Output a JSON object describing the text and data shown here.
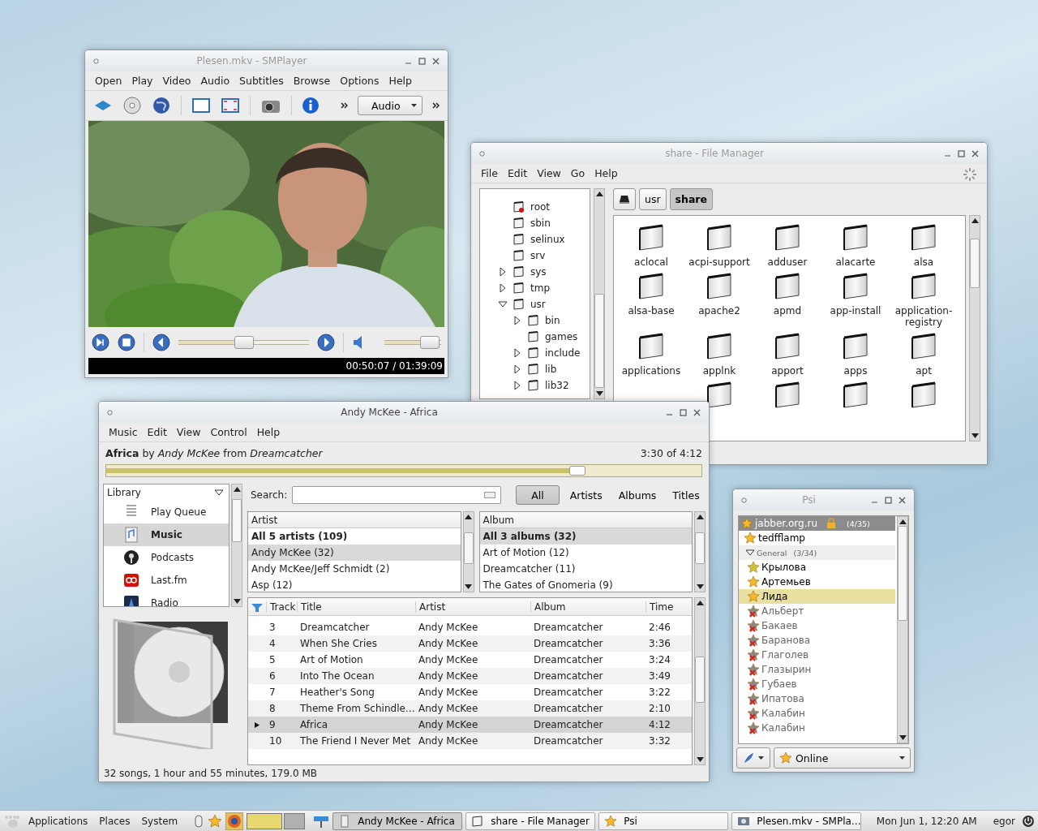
{
  "smplayer": {
    "title": "Plesen.mkv - SMPlayer",
    "active": false,
    "menu": [
      "Open",
      "Play",
      "Video",
      "Audio",
      "Subtitles",
      "Browse",
      "Options",
      "Help"
    ],
    "audio_combo": "Audio",
    "seek": {
      "level": 0.5
    },
    "volume": {
      "level": 0.95
    },
    "time": "00:50:07 / 01:39:09"
  },
  "file_manager": {
    "title": "share - File Manager",
    "active": false,
    "menu": [
      "File",
      "Edit",
      "View",
      "Go",
      "Help"
    ],
    "path": [
      {
        "label": "usr",
        "selected": false
      },
      {
        "label": "share",
        "selected": true
      }
    ],
    "tree": [
      {
        "name": "root",
        "kind": "restricted"
      },
      {
        "name": "sbin",
        "kind": "folder"
      },
      {
        "name": "selinux",
        "kind": "folder"
      },
      {
        "name": "srv",
        "kind": "folder"
      },
      {
        "name": "sys",
        "kind": "folder",
        "expanded": false
      },
      {
        "name": "tmp",
        "kind": "folder",
        "expanded": false
      },
      {
        "name": "usr",
        "kind": "folder",
        "expanded": true,
        "children": [
          {
            "name": "bin",
            "kind": "folder",
            "expanded": false
          },
          {
            "name": "games",
            "kind": "folder"
          },
          {
            "name": "include",
            "kind": "folder",
            "expanded": false
          },
          {
            "name": "lib",
            "kind": "folder",
            "expanded": false
          },
          {
            "name": "lib32",
            "kind": "folder",
            "expanded": false
          }
        ]
      }
    ],
    "folders": [
      "aclocal",
      "acpi-support",
      "adduser",
      "alacarte",
      "alsa",
      "alsa-base",
      "apache2",
      "apmd",
      "app-install",
      "application-registry",
      "applications",
      "applnk",
      "apport",
      "apps",
      "apt"
    ]
  },
  "music_player": {
    "title": "Andy McKee - Africa",
    "active": true,
    "menu": [
      "Music",
      "Edit",
      "View",
      "Control",
      "Help"
    ],
    "now_playing": "**Africa** by *Andy McKee* from *Dreamcatcher*",
    "position": "3:30 of 4:12",
    "progress": {
      "level": 0.8
    },
    "library_label": "Library",
    "sources": [
      {
        "label": "Play Queue",
        "kind": "queue",
        "selected": false
      },
      {
        "label": "Music",
        "kind": "music",
        "selected": true
      },
      {
        "label": "Podcasts",
        "kind": "podcast",
        "selected": false
      },
      {
        "label": "Last.fm",
        "kind": "lastfm",
        "selected": false
      },
      {
        "label": "Radio",
        "kind": "radio",
        "selected": false
      }
    ],
    "search_label": "Search:",
    "filters": [
      {
        "label": "All",
        "selected": true
      },
      {
        "label": "Artists",
        "selected": false
      },
      {
        "label": "Albums",
        "selected": false
      },
      {
        "label": "Titles",
        "selected": false
      }
    ],
    "artists": {
      "header": "Artist",
      "rows": [
        {
          "label": "All 5 artists (109)",
          "kind": "all",
          "selected": false
        },
        {
          "label": "Andy McKee (32)",
          "kind": "item",
          "selected": true
        },
        {
          "label": "Andy McKee/Jeff Schmidt (2)",
          "kind": "item",
          "selected": false
        },
        {
          "label": "Asp (12)",
          "kind": "item",
          "selected": false
        }
      ]
    },
    "albums": {
      "header": "Album",
      "rows": [
        {
          "label": "All 3 albums (32)",
          "kind": "all",
          "selected": true
        },
        {
          "label": "Art of Motion (12)",
          "kind": "item",
          "selected": false
        },
        {
          "label": "Dreamcatcher (11)",
          "kind": "item",
          "selected": false
        },
        {
          "label": "The Gates of Gnomeria (9)",
          "kind": "item",
          "selected": false
        }
      ]
    },
    "tracks": {
      "columns": [
        "Track",
        "Title",
        "Artist",
        "Album",
        "Time"
      ],
      "rows": [
        {
          "track": "3",
          "title": "Dreamcatcher",
          "artist": "Andy McKee",
          "album": "Dreamcatcher",
          "time": "2:46",
          "playing": false,
          "selected": false
        },
        {
          "track": "4",
          "title": "When She Cries",
          "artist": "Andy McKee",
          "album": "Dreamcatcher",
          "time": "3:36",
          "playing": false,
          "selected": false
        },
        {
          "track": "5",
          "title": "Art of Motion",
          "artist": "Andy McKee",
          "album": "Dreamcatcher",
          "time": "3:24",
          "playing": false,
          "selected": false
        },
        {
          "track": "6",
          "title": "Into The Ocean",
          "artist": "Andy McKee",
          "album": "Dreamcatcher",
          "time": "3:49",
          "playing": false,
          "selected": false
        },
        {
          "track": "7",
          "title": "Heather's Song",
          "artist": "Andy McKee",
          "album": "Dreamcatcher",
          "time": "3:22",
          "playing": false,
          "selected": false
        },
        {
          "track": "8",
          "title": "Theme From Schindle…",
          "artist": "Andy McKee",
          "album": "Dreamcatcher",
          "time": "2:10",
          "playing": false,
          "selected": false
        },
        {
          "track": "9",
          "title": "Africa",
          "artist": "Andy McKee",
          "album": "Dreamcatcher",
          "time": "4:12",
          "playing": true,
          "selected": true
        },
        {
          "track": "10",
          "title": "The Friend I Never Met",
          "artist": "Andy McKee",
          "album": "Dreamcatcher",
          "time": "3:32",
          "playing": false,
          "selected": false
        }
      ]
    },
    "status": "32 songs, 1 hour and 55 minutes, 179.0 MB"
  },
  "psi": {
    "title": "Psi",
    "active": false,
    "account": {
      "name": "jabber.org.ru",
      "count": "(4/35)",
      "contacts": [
        {
          "name": "tedfflamp",
          "kind": "online",
          "selected": false
        }
      ],
      "groups": [
        {
          "name": "General",
          "count": "(3/34)",
          "expanded": true,
          "contacts": [
            {
              "name": "Крылова",
              "kind": "chat",
              "selected": false
            },
            {
              "name": "Артемьев",
              "kind": "online",
              "selected": false
            },
            {
              "name": "Лида",
              "kind": "online",
              "selected": true
            },
            {
              "name": "Альберт",
              "kind": "offline",
              "selected": false
            },
            {
              "name": "Бакаев",
              "kind": "offline",
              "selected": false
            },
            {
              "name": "Баранова",
              "kind": "offline",
              "selected": false
            },
            {
              "name": "Глаголев",
              "kind": "offline",
              "selected": false
            },
            {
              "name": "Глазырин",
              "kind": "offline",
              "selected": false
            },
            {
              "name": "Губаев",
              "kind": "offline",
              "selected": false
            },
            {
              "name": "Ипатова",
              "kind": "offline",
              "selected": false
            },
            {
              "name": "Калабин",
              "kind": "offline",
              "selected": false
            },
            {
              "name": "Калабин",
              "kind": "offline",
              "selected": false
            }
          ]
        }
      ]
    },
    "presence": "Online"
  },
  "taskbar": {
    "menus": [
      "Applications",
      "Places",
      "System"
    ],
    "workspaces": [
      {
        "selected": true
      },
      {
        "selected": false
      }
    ],
    "tasks": [
      {
        "label": "Andy McKee - Africa",
        "kind": "music",
        "selected": true
      },
      {
        "label": "share - File Manager",
        "kind": "folder",
        "selected": false
      },
      {
        "label": "Psi",
        "kind": "star",
        "selected": false
      },
      {
        "label": "Plesen.mkv - SMPla…",
        "kind": "video",
        "selected": false
      }
    ],
    "clock": "Mon Jun 1, 12:20 AM",
    "user": "egor"
  }
}
